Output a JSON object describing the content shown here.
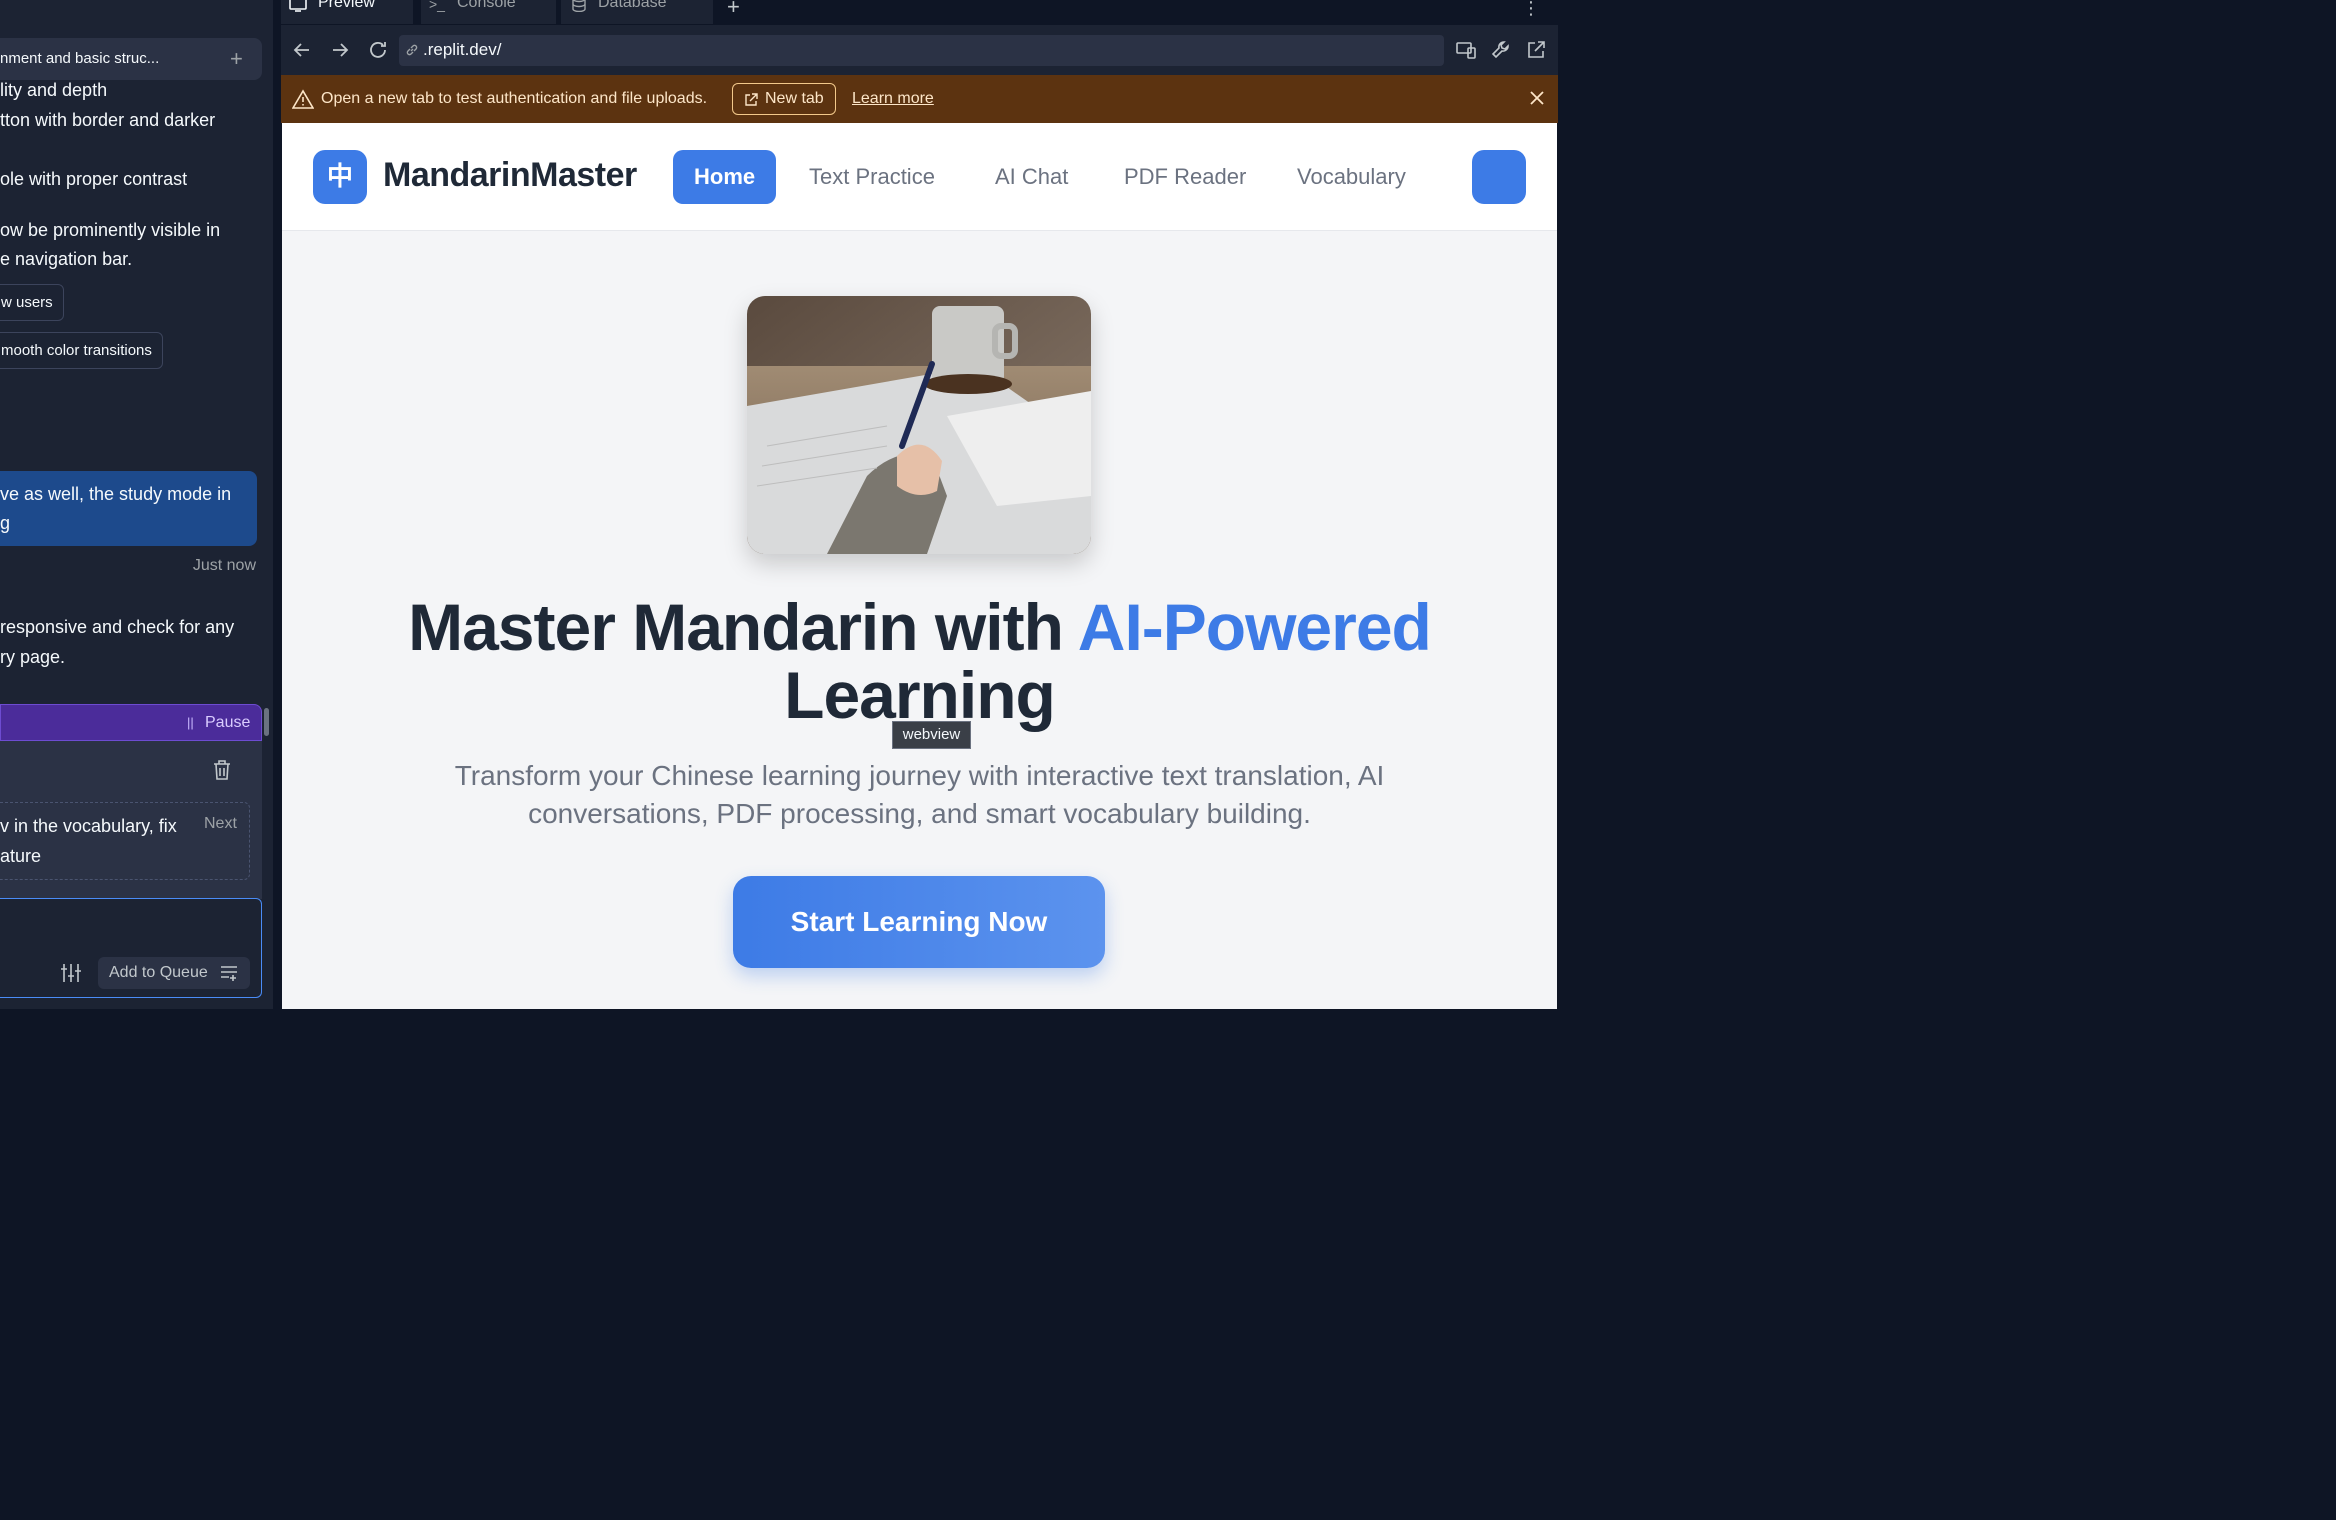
{
  "agent_panel": {
    "task_title": "nment and basic struc...",
    "lines": [
      "lity and depth",
      "tton with border and darker",
      "ole with proper contrast",
      "ow be prominently visible in",
      "e navigation bar."
    ],
    "chips": [
      "w users",
      "mooth color transitions"
    ],
    "user_message": [
      "ve as well, the study mode in",
      "g"
    ],
    "timestamp": "Just now",
    "agent_reply": [
      "responsive and check for any",
      "ry page."
    ],
    "queue": {
      "pause_label": "Pause",
      "item_text": [
        "v in the vocabulary, fix",
        "ature"
      ],
      "next_label": "Next"
    },
    "add_to_queue_label": "Add to Queue"
  },
  "tabs": [
    {
      "label": "Preview",
      "icon": "monitor-icon"
    },
    {
      "label": "Console",
      "icon": "terminal-icon"
    },
    {
      "label": "Database",
      "icon": "database-icon"
    }
  ],
  "url": ".replit.dev/",
  "banner": {
    "message": "Open a new tab to test authentication and file uploads.",
    "new_tab_label": "New tab",
    "learn_more_label": "Learn more"
  },
  "site": {
    "logo_char": "中",
    "brand": "MandarinMaster",
    "nav": [
      "Home",
      "Text Practice",
      "AI Chat",
      "PDF Reader",
      "Vocabulary"
    ],
    "hero_title_part1": "Master Mandarin with ",
    "hero_title_accent": "AI-Powered",
    "hero_title_part2": "Learning",
    "hero_subtitle": "Transform your Chinese learning journey with interactive text translation, AI conversations, PDF processing, and smart vocabulary building.",
    "cta_label": "Start Learning Now",
    "tooltip": "webview"
  },
  "colors": {
    "accent": "#3d7be6",
    "banner_bg": "#5c3310",
    "panel_bg": "#1c2333",
    "queue_bar": "#4b2c9a"
  }
}
